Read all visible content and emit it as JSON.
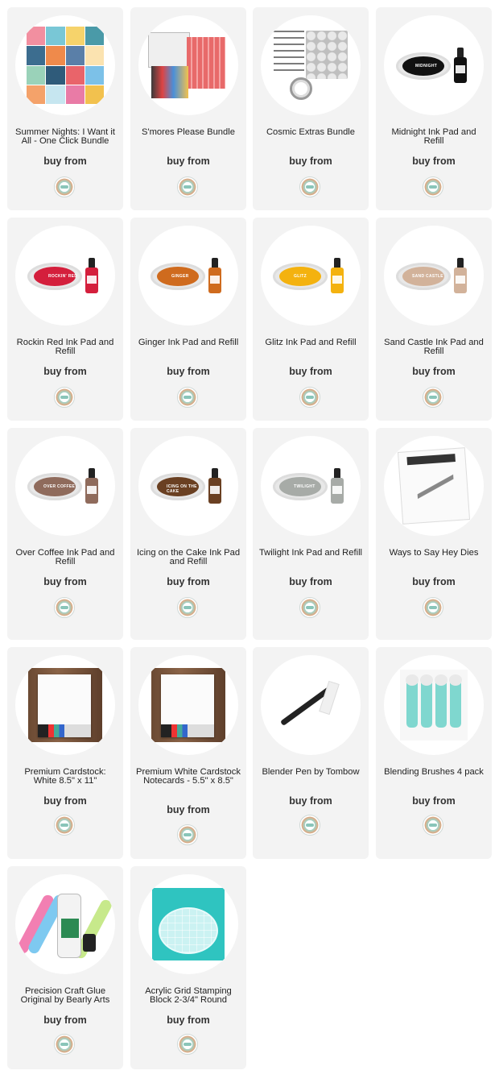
{
  "cta_label": "buy from",
  "products": [
    {
      "title": "Summer Nights: I Want it All - One Click Bundle"
    },
    {
      "title": "S'mores Please Bundle"
    },
    {
      "title": "Cosmic Extras Bundle"
    },
    {
      "title": "Midnight Ink Pad and Refill",
      "pad_label": "MIDNIGHT",
      "color": "#111111"
    },
    {
      "title": "Rockin Red Ink Pad and Refill",
      "pad_label": "ROCKIN' RED",
      "color": "#d41f3c"
    },
    {
      "title": "Ginger Ink Pad and Refill",
      "pad_label": "GINGER",
      "color": "#cf6b1e"
    },
    {
      "title": "Glitz Ink Pad and Refill",
      "pad_label": "GLITZ",
      "color": "#f4b20f"
    },
    {
      "title": "Sand Castle Ink Pad and Refill",
      "pad_label": "SAND CASTLE",
      "color": "#d2b29a"
    },
    {
      "title": "Over Coffee Ink Pad and Refill",
      "pad_label": "OVER COFFEE",
      "color": "#8f6b5c"
    },
    {
      "title": "Icing on the Cake Ink Pad and Refill",
      "pad_label": "ICING ON THE CAKE",
      "color": "#6a4022"
    },
    {
      "title": "Twilight Ink Pad and Refill",
      "pad_label": "TWILIGHT",
      "color": "#a7aba7"
    },
    {
      "title": "Ways to Say Hey Dies"
    },
    {
      "title": "Premium Cardstock: White 8.5\" x 11\""
    },
    {
      "title": "Premium White Cardstock Notecards - 5.5\" x 8.5\""
    },
    {
      "title": "Blender Pen by Tombow"
    },
    {
      "title": "Blending Brushes 4 pack"
    },
    {
      "title": "Precision Craft Glue Original by Bearly Arts"
    },
    {
      "title": "Acrylic Grid Stamping Block 2-3/4\" Round"
    }
  ]
}
